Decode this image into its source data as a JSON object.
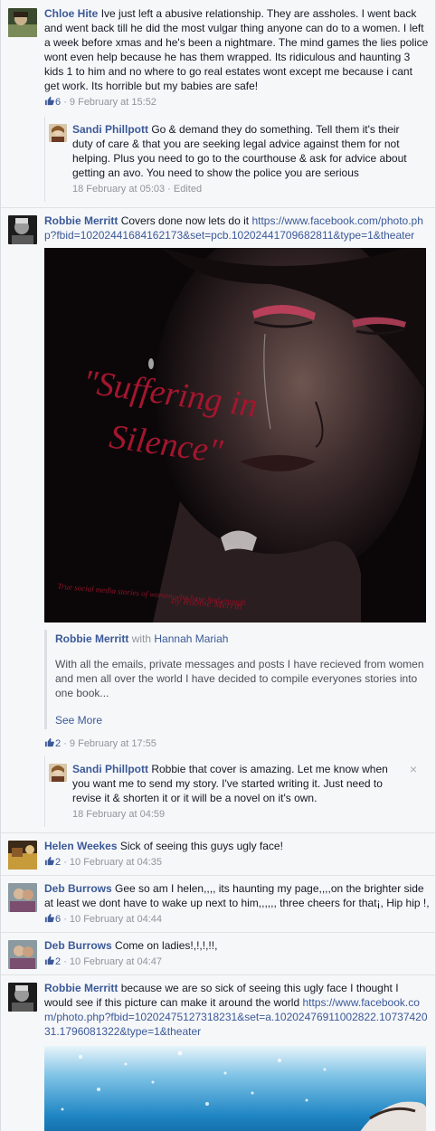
{
  "comments": [
    {
      "name": "Chloe Hite",
      "text": "Ive just left a abusive relationship. They are assholes. I went back and went back till he did the most vulgar thing anyone can do to a women. I left a week before xmas and he's been a nightmare. The mind games the lies police wont even help because he has them wrapped. Its ridiculous and haunting 3 kids 1 to him and no where to go real estates wont except me because i cant get work. Its horrible but my babies are safe!",
      "likes": "6",
      "time": "9 February at 15:52",
      "reply": {
        "name": "Sandi Phillpott",
        "text": "Go & demand they do something. Tell them it's their duty of care & that you are seeking legal advice against them for not helping. Plus you need to go to the courthouse & ask for advice about getting an avo. You need to show the police you are serious",
        "time": "18 February at 05:03",
        "edited": "Edited"
      }
    },
    {
      "name": "Robbie Merritt",
      "text": "Covers done now lets do it",
      "link": "https://www.facebook.com/photo.php?fbid=10202441684162173&set=pcb.10202441709682811&type=1&theater",
      "photo_title_1": "\"Suffering in",
      "photo_title_2": "Silence\"",
      "photo_caption_1": "True social media stories of women who have had enough",
      "photo_caption_2": "by Robbie Merritt",
      "share_name": "Robbie Merritt",
      "share_with": "with",
      "share_tagged": "Hannah Mariah",
      "share_text": "With all the emails, private messages and posts I have recieved from women and men all over the world I have decided to compile everyones stories into one book...",
      "see_more": "See More",
      "likes": "2",
      "time": "9 February at 17:55",
      "reply": {
        "name": "Sandi Phillpott",
        "text": "Robbie that cover is amazing. Let me know when you want me to send my story. I've started writing it. Just need to revise it & shorten it or it will be a novel on it's own.",
        "time": "18 February at 04:59",
        "close": "×"
      }
    },
    {
      "name": "Helen Weekes",
      "text": "Sick of seeing this guys ugly face!",
      "likes": "2",
      "time": "10 February at 04:35"
    },
    {
      "name": "Deb Burrows",
      "text": "Gee so am I helen,,,, its haunting my page,,,,on the brighter side at least we dont have to wake up next to him,,,,,, three cheers for that¡, Hip hip !,",
      "likes": "6",
      "time": "10 February at 04:44"
    },
    {
      "name": "Deb Burrows",
      "text": "Come on ladies!,!,!,!!,",
      "likes": "2",
      "time": "10 February at 04:47"
    },
    {
      "name": "Robbie Merritt",
      "text": "because we are so sick of seeing this ugly face I thought I would see if this picture can make it around the world",
      "link": "https://www.facebook.com/photo.php?fbid=10202475127318231&set=a.10202476911002822.1073742031.1796081322&type=1&theater"
    }
  ],
  "sep": " · ",
  "colors": {
    "link": "#3b5998",
    "meta": "#90949c",
    "background": "#f6f7f9"
  }
}
